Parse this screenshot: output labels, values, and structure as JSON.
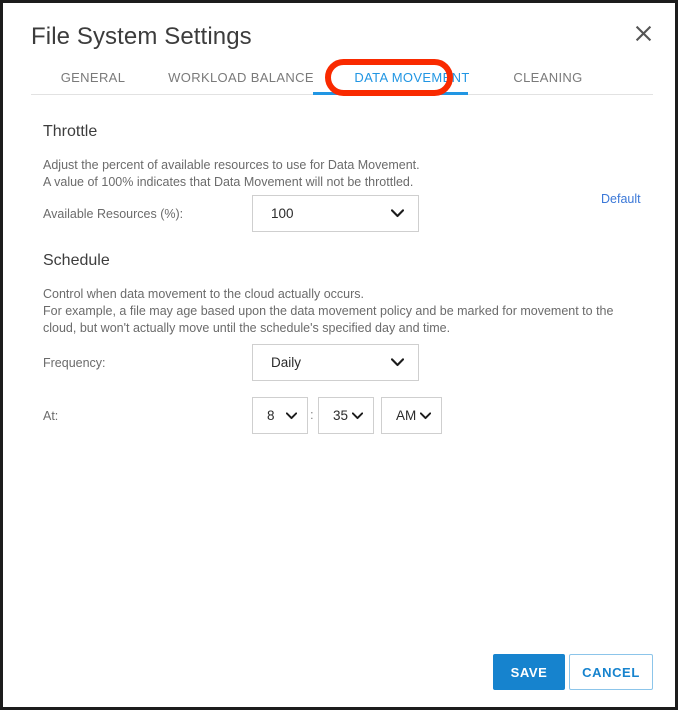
{
  "dialog": {
    "title": "File System Settings",
    "close_icon": "close-icon"
  },
  "tabs": [
    {
      "id": "general",
      "label": "GENERAL",
      "active": false
    },
    {
      "id": "workload",
      "label": "WORKLOAD BALANCE",
      "active": false
    },
    {
      "id": "datamove",
      "label": "DATA MOVEMENT",
      "active": true
    },
    {
      "id": "cleaning",
      "label": "CLEANING",
      "active": false
    }
  ],
  "annotation": {
    "shape": "rounded-rectangle-ring",
    "color": "#f92a00",
    "targets_tab": "DATA MOVEMENT"
  },
  "throttle": {
    "heading": "Throttle",
    "description": "Adjust the percent of available resources to use for Data Movement.\nA value of 100% indicates that Data Movement will not be throttled.",
    "available_resources_label": "Available Resources (%):",
    "available_resources_value": "100",
    "default_link_label": "Default"
  },
  "schedule": {
    "heading": "Schedule",
    "description": "Control when data movement to the cloud actually occurs.\nFor example, a file may age based upon the data movement policy and be marked for movement to the cloud, but won't actually move until the schedule's specified day and time.",
    "frequency_label": "Frequency:",
    "frequency_value": "Daily",
    "at_label": "At:",
    "time_separator": ":",
    "hour_value": "8",
    "minute_value": "35",
    "meridiem_value": "AM"
  },
  "footer": {
    "save_label": "SAVE",
    "cancel_label": "CANCEL"
  },
  "colors": {
    "accent_blue": "#2196e3",
    "button_blue": "#1683ce",
    "link_blue": "#3b78d8",
    "annotation_red": "#f92a00",
    "text_dark": "#3c3c3c",
    "text_muted": "#6b6b6b"
  }
}
